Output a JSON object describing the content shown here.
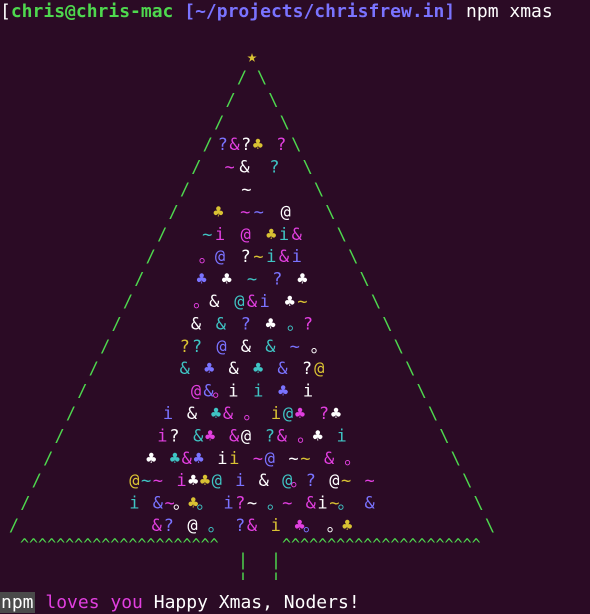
{
  "terminal": {
    "prompt": {
      "open_bracket": "[",
      "user_host": "chris@chris-mac",
      "path": "[~/projects/chrisfrew.in]",
      "command": "npm xmas"
    },
    "tree": {
      "star": "★",
      "left_branch": "/",
      "right_branch": "\\",
      "garland": "^^^^^^^^^^^^^^^^^^^^^^",
      "trunk": "|",
      "rows": [
        "?&?♣ ?",
        "~& ?",
        "~",
        "♣ ~~ @",
        "~i @ ♣i&",
        "。@ ?~i&i",
        "♣ ♣ ~ ? ♣",
        "。& @&i ♣~",
        "& & ? ♣ 。?",
        "?? @ & & ~ 。",
        "& ♣ & ♣ & ?@",
        "@&。i i ♣ i",
        "i & ♣& 。 i@♣ ?♣",
        "i? &♣ &@ ?& 。♣ i",
        "♣ ♣&♣ ii ~@ ~~ & 。",
        "@~~ i♣♣@ i & @。? @~ ~",
        "i &~。♣。 i?~ 。~ &i~。 &",
        "&? @ 。 ?& i ♣。 。♣"
      ]
    },
    "footer": {
      "npm_label": "npm",
      "loves_label": "loves you",
      "message": "Happy Xmas, Noders!"
    },
    "colors": {
      "background": "#2b0b25",
      "green": "#4ed84e",
      "purple": "#7a73ff",
      "magenta": "#e23fe0",
      "yellow": "#d9c233",
      "cyan": "#3fc4c4",
      "white": "#ffffff"
    }
  }
}
